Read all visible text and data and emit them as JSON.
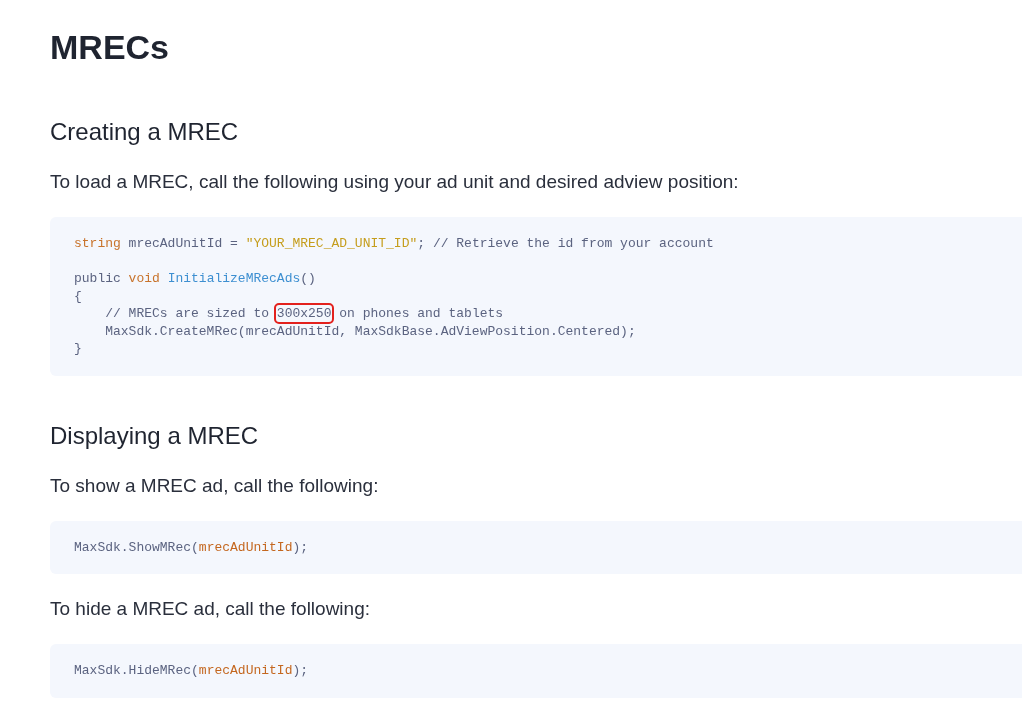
{
  "title": "MRECs",
  "sections": [
    {
      "heading": "Creating a MREC",
      "blocks": [
        {
          "kind": "text",
          "text": "To load a MREC, call the following using your ad unit and desired adview position:"
        },
        {
          "kind": "code",
          "groups": [
            [
              [
                {
                  "kind": "keyword",
                  "text": "string"
                },
                {
                  "kind": "plain",
                  "text": " mrecAdUnitId = "
                },
                {
                  "kind": "string",
                  "text": "\"YOUR_MREC_AD_UNIT_ID\""
                },
                {
                  "kind": "plain",
                  "text": "; // Retrieve the id from your account"
                }
              ]
            ],
            [
              [
                {
                  "kind": "plain",
                  "text": "public "
                },
                {
                  "kind": "keyword",
                  "text": "void "
                },
                {
                  "kind": "function",
                  "text": "InitializeMRecAds"
                },
                {
                  "kind": "plain",
                  "text": "()"
                }
              ],
              [
                {
                  "kind": "plain",
                  "text": "{"
                }
              ],
              [
                {
                  "kind": "plain",
                  "text": "    // MRECs are sized to "
                },
                {
                  "kind": "boxed",
                  "text": "300x250"
                },
                {
                  "kind": "plain",
                  "text": " on phones and tablets"
                }
              ],
              [
                {
                  "kind": "plain",
                  "text": "    MaxSdk.CreateMRec(mrecAdUnitId, MaxSdkBase.AdViewPosition.Centered);"
                }
              ],
              [
                {
                  "kind": "plain",
                  "text": "}"
                }
              ]
            ]
          ]
        }
      ]
    },
    {
      "heading": "Displaying a MREC",
      "blocks": [
        {
          "kind": "text",
          "text": "To show a MREC ad, call the following:"
        },
        {
          "kind": "code",
          "groups": [
            [
              [
                {
                  "kind": "plain",
                  "text": "MaxSdk.ShowMRec("
                },
                {
                  "kind": "variable",
                  "text": "mrecAdUnitId"
                },
                {
                  "kind": "plain",
                  "text": ");"
                }
              ]
            ]
          ]
        },
        {
          "kind": "text",
          "text": "To hide a MREC ad, call the following:"
        },
        {
          "kind": "code",
          "groups": [
            [
              [
                {
                  "kind": "plain",
                  "text": "MaxSdk.HideMRec("
                },
                {
                  "kind": "variable",
                  "text": "mrecAdUnitId"
                },
                {
                  "kind": "plain",
                  "text": ");"
                }
              ]
            ]
          ]
        }
      ]
    }
  ]
}
